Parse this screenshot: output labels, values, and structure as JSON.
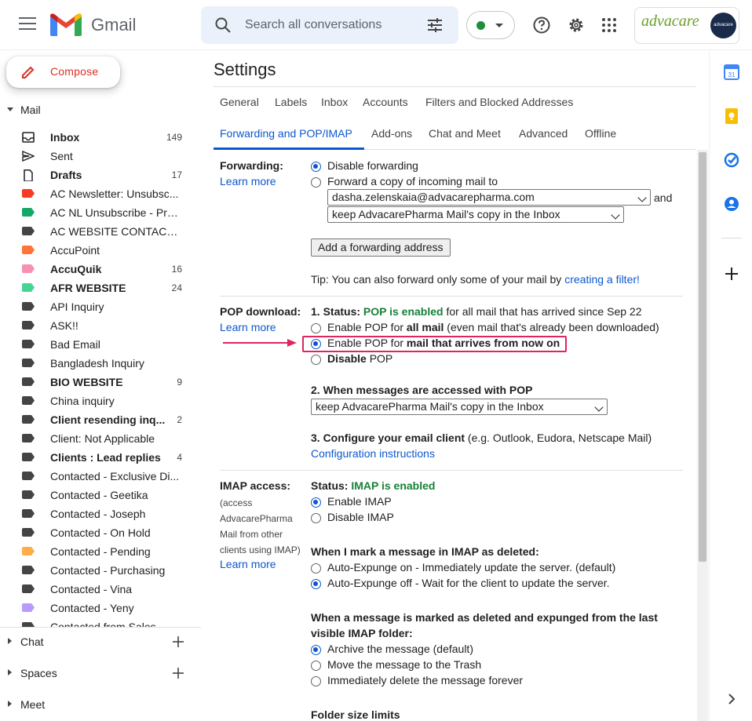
{
  "app": {
    "name": "Gmail"
  },
  "search": {
    "placeholder": "Search all conversations"
  },
  "account": {
    "logo_text_a": "advacare",
    "logo_sub": "PHARMA",
    "avatar_text": "advacare"
  },
  "sidebar": {
    "compose_label": "Compose",
    "mail_header": "Mail",
    "labels": [
      {
        "name": "Inbox",
        "count": "149",
        "bold": true,
        "icon": "inbox-icon",
        "color": ""
      },
      {
        "name": "Sent",
        "count": "",
        "bold": false,
        "icon": "send-icon",
        "color": ""
      },
      {
        "name": "Drafts",
        "count": "17",
        "bold": true,
        "icon": "draft-icon",
        "color": ""
      },
      {
        "name": "AC Newsletter: Unsubsc...",
        "count": "",
        "bold": false,
        "icon": "label-icon",
        "color": "#f83a22"
      },
      {
        "name": "AC NL Unsubscribe - Pro...",
        "count": "",
        "bold": false,
        "icon": "label-icon",
        "color": "#16a765"
      },
      {
        "name": "AC WEBSITE CONTACT ...",
        "count": "",
        "bold": false,
        "icon": "label-icon",
        "color": "#444444"
      },
      {
        "name": "AccuPoint",
        "count": "",
        "bold": false,
        "icon": "label-icon",
        "color": "#ff7537"
      },
      {
        "name": "AccuQuik",
        "count": "16",
        "bold": true,
        "icon": "label-icon",
        "color": "#f691b2"
      },
      {
        "name": "AFR WEBSITE",
        "count": "24",
        "bold": true,
        "icon": "label-icon",
        "color": "#43d692"
      },
      {
        "name": "API Inquiry",
        "count": "",
        "bold": false,
        "icon": "label-icon",
        "color": "#444444"
      },
      {
        "name": "ASK!!",
        "count": "",
        "bold": false,
        "icon": "label-icon",
        "color": "#444444"
      },
      {
        "name": "Bad Email",
        "count": "",
        "bold": false,
        "icon": "label-icon",
        "color": "#444444"
      },
      {
        "name": "Bangladesh Inquiry",
        "count": "",
        "bold": false,
        "icon": "label-icon",
        "color": "#444444"
      },
      {
        "name": "BIO WEBSITE",
        "count": "9",
        "bold": true,
        "icon": "label-icon",
        "color": "#444444"
      },
      {
        "name": "China inquiry",
        "count": "",
        "bold": false,
        "icon": "label-icon",
        "color": "#444444"
      },
      {
        "name": "Client resending inq...",
        "count": "2",
        "bold": true,
        "icon": "label-icon",
        "color": "#444444"
      },
      {
        "name": "Client: Not Applicable",
        "count": "",
        "bold": false,
        "icon": "label-icon",
        "color": "#444444"
      },
      {
        "name": "Clients : Lead replies",
        "count": "4",
        "bold": true,
        "icon": "label-icon",
        "color": "#444444"
      },
      {
        "name": "Contacted - Exclusive Di...",
        "count": "",
        "bold": false,
        "icon": "label-icon",
        "color": "#444444"
      },
      {
        "name": "Contacted - Geetika",
        "count": "",
        "bold": false,
        "icon": "label-icon",
        "color": "#444444"
      },
      {
        "name": "Contacted - Joseph",
        "count": "",
        "bold": false,
        "icon": "label-icon",
        "color": "#444444"
      },
      {
        "name": "Contacted - On Hold",
        "count": "",
        "bold": false,
        "icon": "label-icon",
        "color": "#444444"
      },
      {
        "name": "Contacted - Pending",
        "count": "",
        "bold": false,
        "icon": "label-icon",
        "color": "#ffad47"
      },
      {
        "name": "Contacted - Purchasing",
        "count": "",
        "bold": false,
        "icon": "label-icon",
        "color": "#444444"
      },
      {
        "name": "Contacted - Vina",
        "count": "",
        "bold": false,
        "icon": "label-icon",
        "color": "#444444"
      },
      {
        "name": "Contacted - Yeny",
        "count": "",
        "bold": false,
        "icon": "label-icon",
        "color": "#b99aff"
      },
      {
        "name": "Contacted from Sales",
        "count": "",
        "bold": false,
        "icon": "label-icon",
        "color": "#444444"
      }
    ],
    "chat_label": "Chat",
    "spaces_label": "Spaces",
    "meet_label": "Meet"
  },
  "settings": {
    "title": "Settings",
    "tabs_row1": [
      "General",
      "Labels",
      "Inbox",
      "Accounts",
      "Filters and Blocked Addresses"
    ],
    "tabs_row2": [
      "Forwarding and POP/IMAP",
      "Add-ons",
      "Chat and Meet",
      "Advanced",
      "Offline"
    ],
    "forwarding": {
      "label": "Forwarding:",
      "learn_more": "Learn more",
      "opt_disable": "Disable forwarding",
      "opt_forward": "Forward a copy of incoming mail to",
      "email_value": "dasha.zelenskaia@advacarepharma.com",
      "and": "and",
      "copy_value": "keep AdvacarePharma Mail's copy in the Inbox",
      "add_button": "Add a forwarding address",
      "tip_prefix": "Tip: You can also forward only some of your mail by ",
      "tip_link": "creating a filter!"
    },
    "pop": {
      "label": "POP download:",
      "learn_more": "Learn more",
      "status_prefix": "1. Status: ",
      "status_value": "POP is enabled",
      "status_suffix": " for all mail that has arrived since Sep 22",
      "opt_all_prefix": "Enable POP for ",
      "opt_all_bold": "all mail",
      "opt_all_suffix": " (even mail that's already been downloaded)",
      "opt_now_prefix": "Enable POP for ",
      "opt_now_bold": "mail that arrives from now on",
      "opt_disable_bold": "Disable",
      "opt_disable_suffix": " POP",
      "when_accessed": "2. When messages are accessed with POP",
      "accessed_value": "keep AdvacarePharma Mail's copy in the Inbox",
      "configure_prefix": "3. Configure your email client",
      "configure_suffix": " (e.g. Outlook, Eudora, Netscape Mail)",
      "config_link": "Configuration instructions"
    },
    "imap": {
      "label": "IMAP access:",
      "sub1": "(access",
      "sub2": "AdvacarePharma",
      "sub3": "Mail from other",
      "sub4": "clients using IMAP)",
      "learn_more": "Learn more",
      "status_prefix": "Status: ",
      "status_value": "IMAP is enabled",
      "opt_enable": "Enable IMAP",
      "opt_disable": "Disable IMAP",
      "deleted_header": "When I mark a message in IMAP as deleted:",
      "expunge_on": "Auto-Expunge on - Immediately update the server. (default)",
      "expunge_off": "Auto-Expunge off - Wait for the client to update the server.",
      "expunged_header_1": "When a message is marked as deleted and expunged from the last",
      "expunged_header_2": "visible IMAP folder:",
      "archive": "Archive the message (default)",
      "trash": "Move the message to the Trash",
      "delete_forever": "Immediately delete the message forever",
      "folder_limits": "Folder size limits"
    }
  },
  "colors": {
    "accent": "#0b57d0",
    "green": "#188038",
    "highlight": "#e0245e"
  }
}
